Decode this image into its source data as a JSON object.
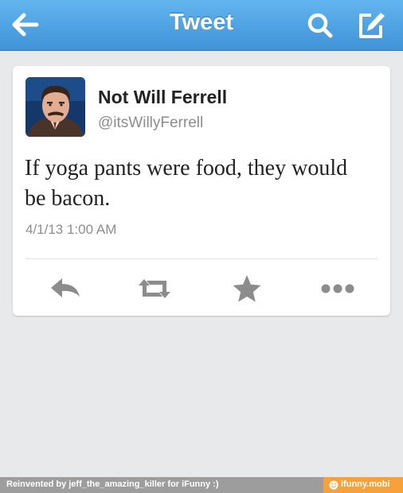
{
  "nav": {
    "title": "Tweet",
    "back_icon": "arrow-left-icon",
    "search_icon": "search-icon",
    "compose_icon": "compose-icon"
  },
  "tweet": {
    "display_name": "Not Will Ferrell",
    "handle": "@itsWillyFerrell",
    "text": "If yoga pants were food, they would be bacon.",
    "timestamp": "4/1/13 1:00 AM"
  },
  "actions": [
    {
      "icon": "reply-icon"
    },
    {
      "icon": "retweet-icon"
    },
    {
      "icon": "star-icon"
    },
    {
      "icon": "more-icon"
    }
  ],
  "footer": {
    "credit": "Reinvented by jeff_the_amazing_killer for iFunny :)",
    "brand": "ifunny.mobi"
  },
  "colors": {
    "nav_top": "#63b5ee",
    "nav_bottom": "#3f93d8",
    "background": "#e8e9ea",
    "icon_gray": "#8c8c8c",
    "brand_orange": "#f5a23a"
  }
}
